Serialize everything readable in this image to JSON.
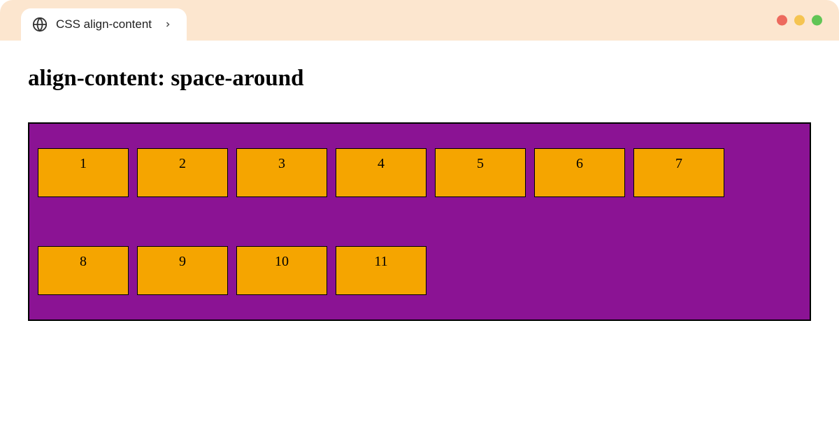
{
  "browser": {
    "tab_title": "CSS align-content"
  },
  "page": {
    "heading": "align-content: space-around"
  },
  "flex": {
    "items": [
      "1",
      "2",
      "3",
      "4",
      "5",
      "6",
      "7",
      "8",
      "9",
      "10",
      "11"
    ]
  },
  "colors": {
    "chrome_bg": "#fce6cf",
    "container_bg": "#8b1394",
    "item_bg": "#f5a500"
  }
}
